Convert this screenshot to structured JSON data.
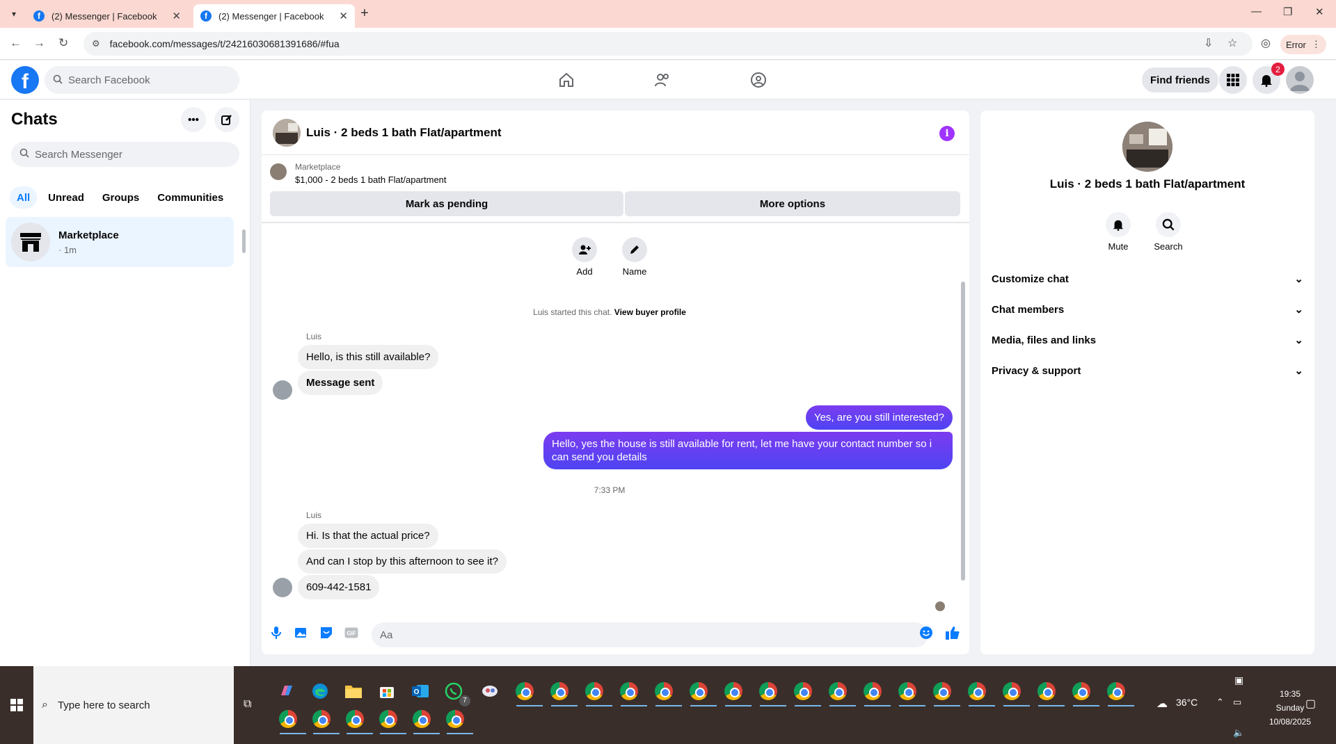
{
  "browser": {
    "tabs": [
      {
        "title": "(2) Messenger | Facebook",
        "active": false
      },
      {
        "title": "(2) Messenger | Facebook",
        "active": true
      }
    ],
    "url": "facebook.com/messages/t/24216030681391686/#fua",
    "error_label": "Error"
  },
  "header": {
    "search_placeholder": "Search Facebook",
    "find_friends": "Find friends",
    "notification_count": "2"
  },
  "chats": {
    "title": "Chats",
    "search_placeholder": "Search Messenger",
    "filters": [
      "All",
      "Unread",
      "Groups",
      "Communities"
    ],
    "active_filter": "All",
    "items": [
      {
        "name": "Marketplace",
        "sub": "· 1m"
      }
    ]
  },
  "conversation": {
    "title": "Luis · 2 beds 1 bath Flat/apartment",
    "marketplace_label": "Marketplace",
    "listing": "$1,000 - 2 beds 1 bath Flat/apartment",
    "mark_pending": "Mark as pending",
    "more_options": "More options",
    "quick_actions": [
      {
        "label": "Add",
        "icon": "add-person-icon"
      },
      {
        "label": "Name",
        "icon": "pencil-icon"
      }
    ],
    "system_message": "Luis started this chat.",
    "system_link": "View buyer profile",
    "sender_name": "Luis",
    "group1": [
      "Hello, is this still available?",
      "Message sent"
    ],
    "outgoing": [
      "Yes, are you still interested?",
      "Hello, yes the house is still available for rent, let me have your contact number so i can send you details"
    ],
    "timestamp": "7:33 PM",
    "group2": [
      "Hi. Is that the actual price?",
      "And can I stop by this afternoon to see it?",
      "609-442-1581"
    ],
    "composer_placeholder": "Aa"
  },
  "info_panel": {
    "name": "Luis · 2 beds 1 bath Flat/apartment",
    "actions": [
      {
        "label": "Mute",
        "icon": "bell-icon"
      },
      {
        "label": "Search",
        "icon": "search-icon"
      }
    ],
    "sections": [
      "Customize chat",
      "Chat members",
      "Media, files and links",
      "Privacy & support"
    ]
  },
  "taskbar": {
    "search_placeholder": "Type here to search",
    "whatsapp_count": "7",
    "weather": "36°C",
    "time": "19:35",
    "day": "Sunday",
    "date": "10/08/2025"
  },
  "colors": {
    "fb_blue": "#1877f2",
    "messenger_purple": "#5c2bff",
    "tab_bar": "#fbd9d2"
  }
}
